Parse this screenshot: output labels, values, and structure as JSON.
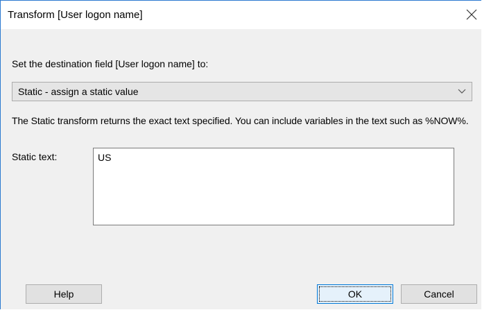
{
  "dialog": {
    "title": "Transform [User logon name]",
    "close_icon": "close-icon",
    "destination_label": "Set the destination field [User logon name] to:",
    "transform_select": {
      "selected": "Static - assign a static value",
      "chevron_icon": "chevron-down-icon"
    },
    "description": "The Static transform returns the exact text specified.  You can include variables in the text such as %NOW%.",
    "static_text": {
      "label": "Static text:",
      "value": "US"
    },
    "buttons": {
      "help": "Help",
      "ok": "OK",
      "cancel": "Cancel"
    }
  },
  "colors": {
    "window_border": "#2b79d0",
    "client_background": "#f0f0f0",
    "default_button_border": "#0078d7"
  }
}
